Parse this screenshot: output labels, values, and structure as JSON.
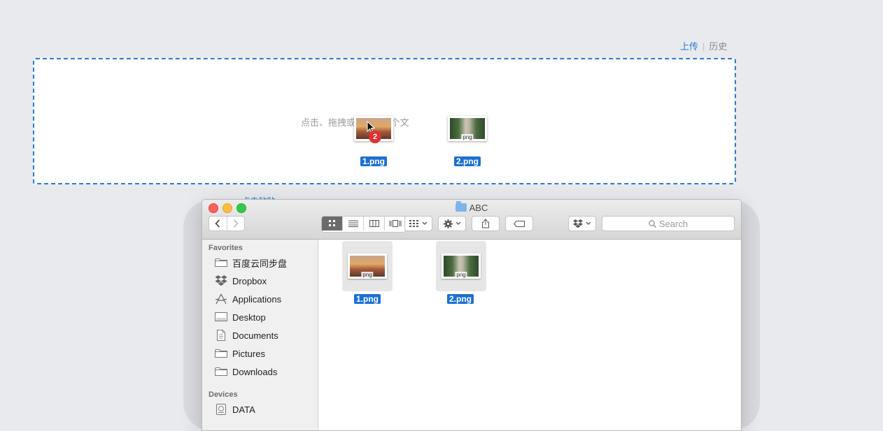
{
  "top_links": {
    "upload": "上传",
    "separator": "|",
    "history": "历史"
  },
  "dropzone": {
    "hint_left": "点击、拖拽或",
    "hint_right": "支持多个文",
    "hint_right_prefix": "~",
    "dragged_files": [
      {
        "name": "1.png",
        "ext": "png"
      },
      {
        "name": "2.png",
        "ext": "png"
      }
    ],
    "drag_count_badge": "2"
  },
  "behind_text": {
    "part1": "…",
    "link": "点击粘贴"
  },
  "finder": {
    "title": "ABC",
    "search_placeholder": "Search",
    "sidebar": {
      "favorites_header": "Favorites",
      "favorites": [
        {
          "label": "百度云同步盘",
          "icon": "folder-icon"
        },
        {
          "label": "Dropbox",
          "icon": "dropbox-icon"
        },
        {
          "label": "Applications",
          "icon": "applications-icon"
        },
        {
          "label": "Desktop",
          "icon": "desktop-icon"
        },
        {
          "label": "Documents",
          "icon": "documents-icon"
        },
        {
          "label": "Pictures",
          "icon": "folder-icon"
        },
        {
          "label": "Downloads",
          "icon": "folder-icon"
        }
      ],
      "devices_header": "Devices",
      "devices": [
        {
          "label": "DATA",
          "icon": "disk-icon"
        }
      ]
    },
    "files": [
      {
        "name": "1.png",
        "ext": "png",
        "thumb": "sunset"
      },
      {
        "name": "2.png",
        "ext": "png",
        "thumb": "forest"
      }
    ]
  },
  "colors": {
    "accent": "#2a7ad8",
    "selection": "#1c6fd4",
    "badge": "#e0312e"
  }
}
